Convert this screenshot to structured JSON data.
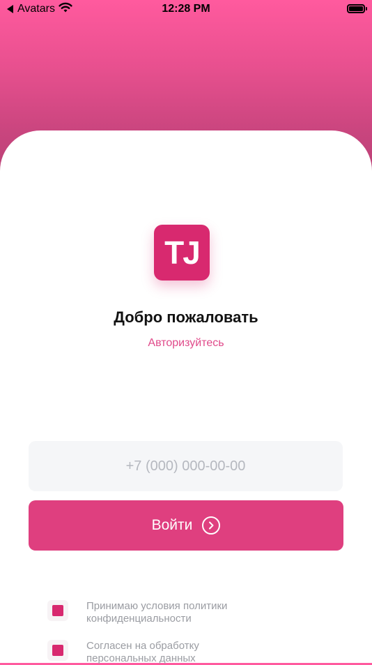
{
  "status_bar": {
    "back_label": "Avatars",
    "time": "12:28 PM"
  },
  "logo": {
    "text": "TJ"
  },
  "welcome": {
    "title": "Добро пожаловать",
    "subtitle": "Авторизуйтесь"
  },
  "phone": {
    "placeholder": "+7 (000) 000-00-00",
    "value": ""
  },
  "login": {
    "label": "Войти",
    "icon": "arrow-right-circle-icon"
  },
  "consents": [
    {
      "line1": "Принимаю условия политики",
      "line2": "конфиденциальности",
      "checked": true
    },
    {
      "line1": "Согласен на обработку",
      "line2": "персональных данных",
      "checked": true
    }
  ],
  "colors": {
    "accent": "#df3f7f",
    "logo": "#d8296f",
    "gradient_top": "#ff5a9e",
    "gradient_bottom": "#b23f71"
  }
}
